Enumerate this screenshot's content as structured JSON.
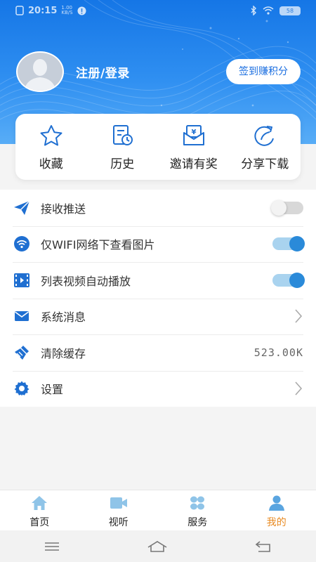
{
  "status_bar": {
    "time": "20:15",
    "network_speed_top": "1.00",
    "network_speed_bottom": "KB/S",
    "battery": "58"
  },
  "profile": {
    "login_text": "注册/登录",
    "checkin_label": "签到赚积分"
  },
  "quick_actions": [
    {
      "label": "收藏",
      "icon": "star-icon"
    },
    {
      "label": "历史",
      "icon": "history-icon"
    },
    {
      "label": "邀请有奖",
      "icon": "gift-envelope-icon"
    },
    {
      "label": "分享下载",
      "icon": "share-icon"
    }
  ],
  "settings": [
    {
      "label": "接收推送",
      "icon": "paper-plane-icon",
      "control": "toggle",
      "state": "off"
    },
    {
      "label": "仅WIFI网络下查看图片",
      "icon": "wifi-icon",
      "control": "toggle",
      "state": "on"
    },
    {
      "label": "列表视频自动播放",
      "icon": "film-icon",
      "control": "toggle",
      "state": "on"
    },
    {
      "label": "系统消息",
      "icon": "envelope-icon",
      "control": "chevron"
    },
    {
      "label": "清除缓存",
      "icon": "broom-icon",
      "control": "value",
      "value": "523.00K"
    },
    {
      "label": "设置",
      "icon": "gear-icon",
      "control": "chevron"
    }
  ],
  "bottom_nav": [
    {
      "label": "首页",
      "icon": "home-icon",
      "active": false
    },
    {
      "label": "视听",
      "icon": "video-camera-icon",
      "active": false
    },
    {
      "label": "服务",
      "icon": "grid-icon",
      "active": false
    },
    {
      "label": "我的",
      "icon": "user-icon",
      "active": true
    }
  ],
  "colors": {
    "header_blue": "#1576e6",
    "accent_blue": "#2a8ad9",
    "active_orange": "#e88a22",
    "nav_icon": "#8fc4e8"
  }
}
